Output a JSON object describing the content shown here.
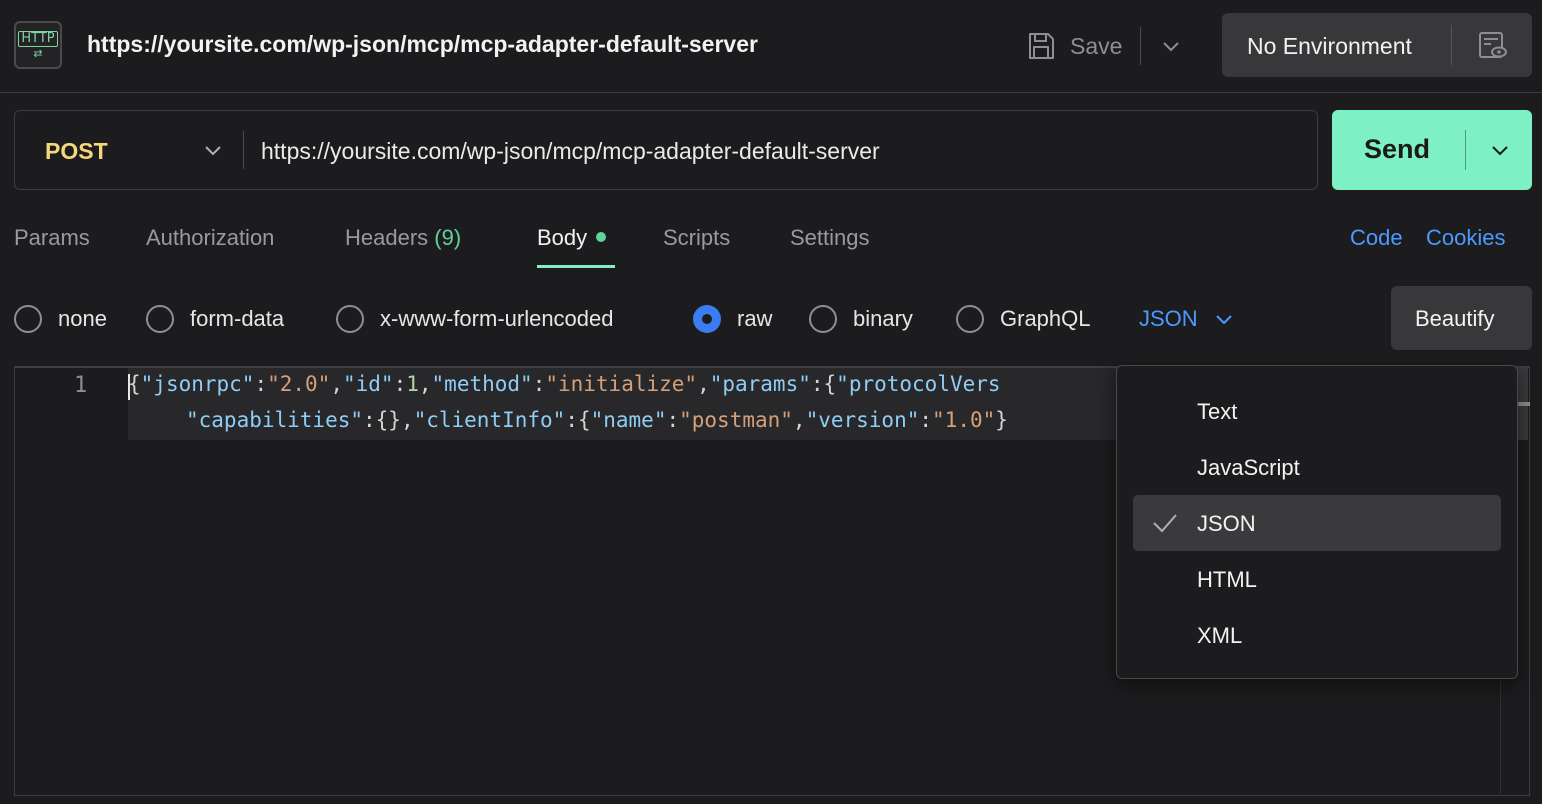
{
  "header": {
    "request_title": "https://yoursite.com/wp-json/mcp/mcp-adapter-default-server",
    "save_label": "Save",
    "environment_label": "No Environment"
  },
  "request": {
    "method": "POST",
    "url": "https://yoursite.com/wp-json/mcp/mcp-adapter-default-server",
    "send_label": "Send"
  },
  "tabs": {
    "params": "Params",
    "authorization": "Authorization",
    "headers": "Headers",
    "headers_count": "(9)",
    "body": "Body",
    "scripts": "Scripts",
    "settings": "Settings",
    "code": "Code",
    "cookies": "Cookies"
  },
  "body_types": {
    "none": "none",
    "form_data": "form-data",
    "urlencoded": "x-www-form-urlencoded",
    "raw": "raw",
    "binary": "binary",
    "graphql": "GraphQL",
    "selected": "raw"
  },
  "language_select": {
    "value": "JSON",
    "options": [
      "Text",
      "JavaScript",
      "JSON",
      "HTML",
      "XML"
    ],
    "selected": "JSON"
  },
  "beautify_label": "Beautify",
  "editor": {
    "line_number": "1",
    "line1": {
      "t1": "{",
      "t2": "\"jsonrpc\"",
      "t3": ":",
      "t4": "\"2.0\"",
      "t5": ",",
      "t6": "\"id\"",
      "t7": ":",
      "t8": "1",
      "t9": ",",
      "t10": "\"method\"",
      "t11": ":",
      "t12": "\"initialize\"",
      "t13": ",",
      "t14": "\"params\"",
      "t15": ":{",
      "t16": "\"protocolVers"
    },
    "line2": {
      "t1": "\"capabilities\"",
      "t2": ":{},",
      "t3": "\"clientInfo\"",
      "t4": ":{",
      "t5": "\"name\"",
      "t6": ":",
      "t7": "\"postman\"",
      "t8": ",",
      "t9": "\"version\"",
      "t10": ":",
      "t11": "\"1.0\"",
      "t12": "}"
    }
  },
  "colors": {
    "accent_green": "#7ef0c6",
    "link_blue": "#4a9aff",
    "method_yellow": "#f5d67a",
    "radio_blue": "#3a7cf2"
  }
}
